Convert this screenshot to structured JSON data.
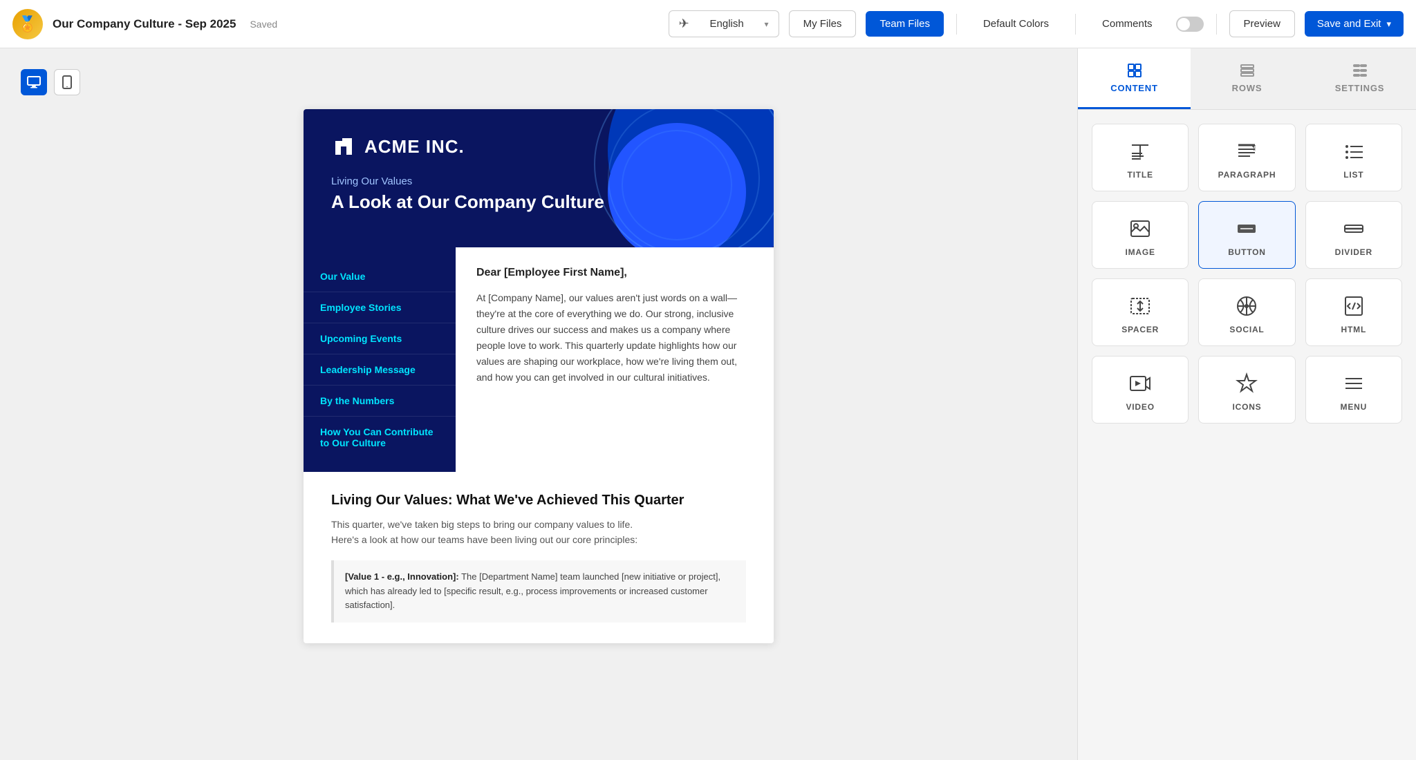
{
  "topbar": {
    "logo_emoji": "🏅",
    "title": "Our Company Culture - Sep 2025",
    "saved_label": "Saved",
    "language": {
      "current": "English",
      "globe_icon": "🌐",
      "chevron": "▾"
    },
    "myfiles_label": "My Files",
    "teamfiles_label": "Team Files",
    "defaultcolors_label": "Default Colors",
    "comments_label": "Comments",
    "preview_label": "Preview",
    "saveexit_label": "Save and Exit",
    "saveexit_chevron": "▾"
  },
  "device_toggle": {
    "desktop_icon": "🖥",
    "mobile_icon": "📱"
  },
  "email": {
    "header": {
      "logo_text": "ACME INC.",
      "tagline": "Living Our Values",
      "headline": "A Look at Our Company Culture"
    },
    "nav_items": [
      {
        "label": "Our Value"
      },
      {
        "label": "Employee Stories"
      },
      {
        "label": "Upcoming Events"
      },
      {
        "label": "Leadership Message"
      },
      {
        "label": "By the Numbers"
      },
      {
        "label": "How You Can Contribute to Our Culture"
      }
    ],
    "body": {
      "greeting": "Dear [Employee First Name],",
      "paragraph": "At [Company Name], our values aren't just words on a wall—they're at the core of everything we do. Our strong, inclusive culture drives our success and makes us a company where people love to work. This quarterly update highlights how our values are shaping our workplace, how we're living them out, and how you can get involved in our cultural initiatives."
    },
    "section": {
      "title": "Living Our Values: What We've Achieved This Quarter",
      "intro": "This quarter, we've taken big steps to bring our company values to life.\nHere's a look at how our teams have been living out our core principles:",
      "value_text": "[Value 1 - e.g., Innovation]: The [Department Name] team launched [new initiative or project], which has already led to [specific result, e.g., process improvements or increased customer satisfaction]."
    }
  },
  "right_panel": {
    "tabs": [
      {
        "id": "content",
        "label": "CONTENT",
        "icon": "grid",
        "active": true
      },
      {
        "id": "rows",
        "label": "ROWS",
        "icon": "rows"
      },
      {
        "id": "settings",
        "label": "SETTINGS",
        "icon": "settings"
      }
    ],
    "content_blocks": [
      {
        "id": "title",
        "label": "TITLE",
        "icon": "title"
      },
      {
        "id": "paragraph",
        "label": "PARAGRAPH",
        "icon": "paragraph"
      },
      {
        "id": "list",
        "label": "LIST",
        "icon": "list"
      },
      {
        "id": "image",
        "label": "IMAGE",
        "icon": "image"
      },
      {
        "id": "button",
        "label": "BUTTON",
        "icon": "button",
        "highlighted": true
      },
      {
        "id": "divider",
        "label": "DIVIDER",
        "icon": "divider"
      },
      {
        "id": "spacer",
        "label": "SPACER",
        "icon": "spacer"
      },
      {
        "id": "social",
        "label": "SOCIAL",
        "icon": "social"
      },
      {
        "id": "html",
        "label": "HTML",
        "icon": "html"
      },
      {
        "id": "video",
        "label": "VIDEO",
        "icon": "video"
      },
      {
        "id": "icons",
        "label": "ICONS",
        "icon": "icons"
      },
      {
        "id": "menu",
        "label": "MENU",
        "icon": "menu"
      }
    ]
  }
}
